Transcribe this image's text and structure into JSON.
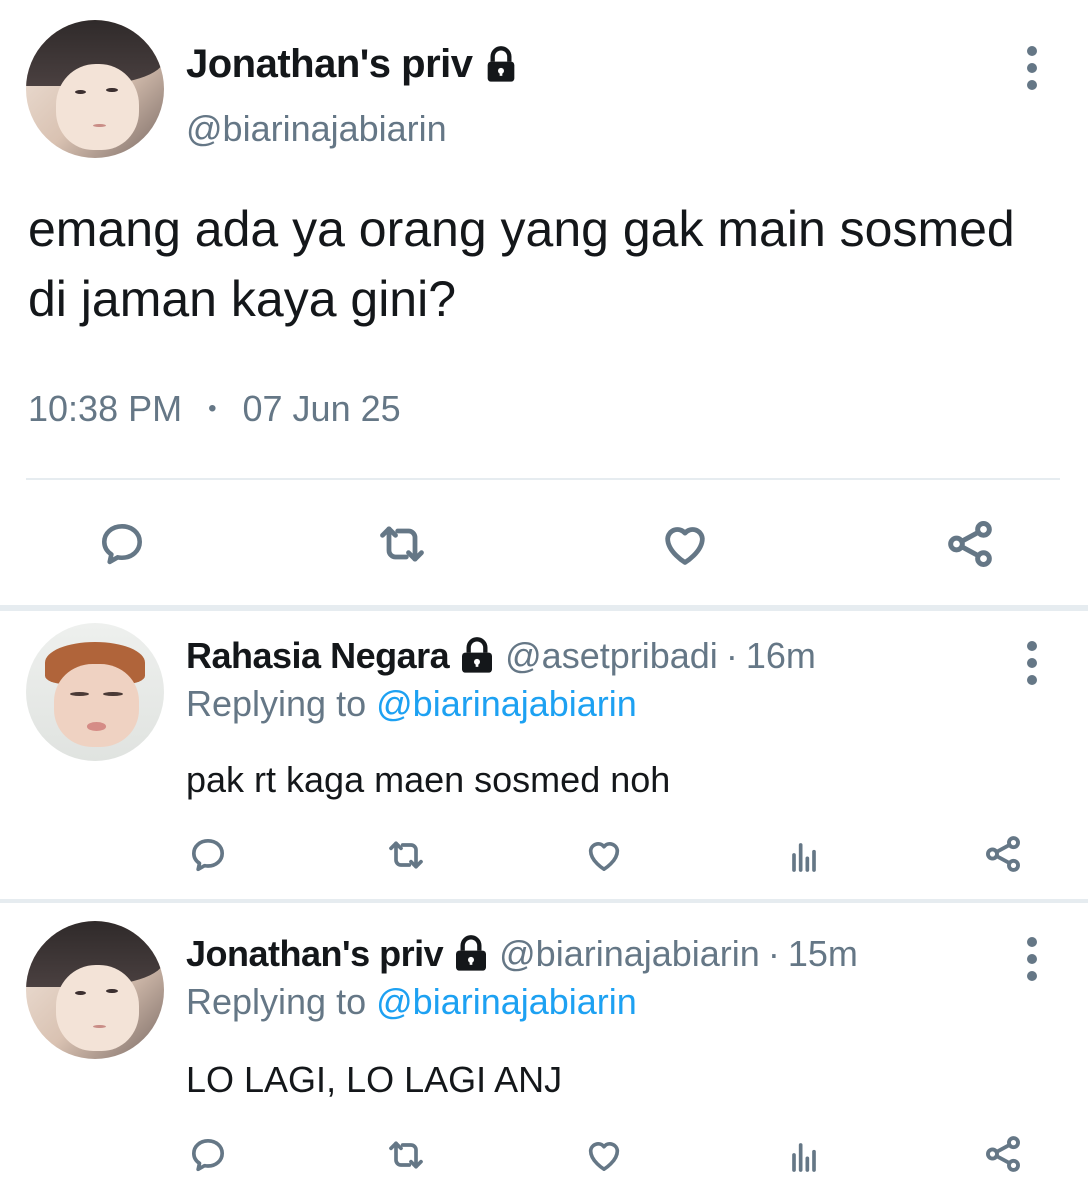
{
  "main_tweet": {
    "name": "Jonathan's priv",
    "handle": "@biarinajabiarin",
    "text": "emang ada ya orang yang gak main sosmed di jaman kaya gini?",
    "time": "10:38 PM",
    "separator": "•",
    "date": "07 Jun 25",
    "icons": [
      "lock-icon",
      "more-options-icon",
      "reply-icon",
      "retweet-icon",
      "like-icon",
      "share-icon"
    ]
  },
  "replies": [
    {
      "name": "Rahasia Negara",
      "handle": "@asetpribadi",
      "dot": "·",
      "age": "16m",
      "replying_prefix": "Replying to",
      "replying_to": "@biarinajabiarin",
      "text": "pak rt kaga maen sosmed noh"
    },
    {
      "name": "Jonathan's priv",
      "handle": "@biarinajabiarin",
      "dot": "·",
      "age": "15m",
      "replying_prefix": "Replying to",
      "replying_to": "@biarinajabiarin",
      "text": "LO LAGI, LO LAGI ANJ"
    }
  ],
  "colors": {
    "text": "#14171a",
    "secondary": "#657786",
    "link": "#1da1f2",
    "divider": "#e6ecf0"
  }
}
